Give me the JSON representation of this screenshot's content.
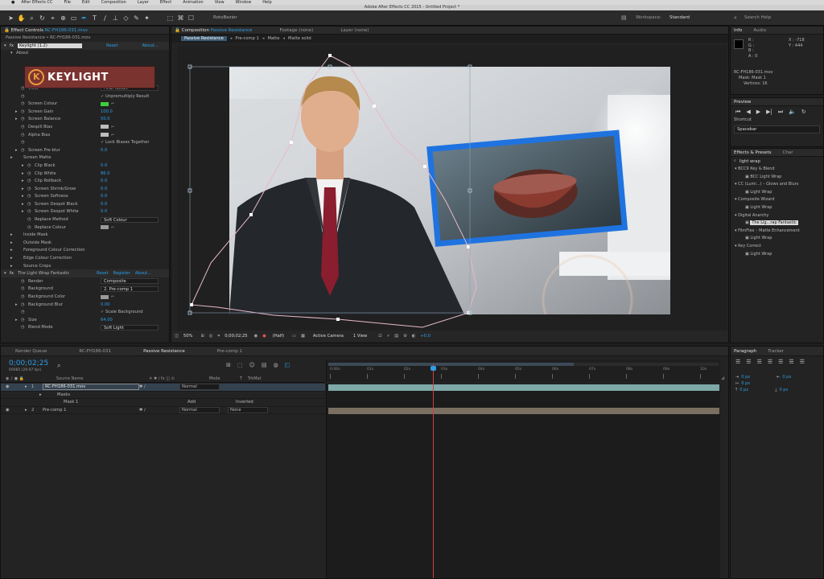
{
  "menubar": {
    "items": [
      "After Effects CC",
      "File",
      "Edit",
      "Composition",
      "Layer",
      "Effect",
      "Animation",
      "View",
      "Window",
      "Help"
    ]
  },
  "window": {
    "title": "Adobe After Effects CC 2015 - Untitled Project *"
  },
  "toolbar": {
    "rotobezier_label": "RotoBezier",
    "workspace_label": "Workspace:",
    "workspace_value": "Standard",
    "search_placeholder": "Search Help"
  },
  "effect_controls": {
    "tab_label": "Effect Controls",
    "tab_file": "RC-FH186-031.mov",
    "breadcrumb": "Passive Resistance • RC-FH186-031.mov",
    "keylight_name": "Keylight (1.2)",
    "reset": "Reset",
    "about": "About...",
    "about_label": "About",
    "logo_text": "KEYLIGHT",
    "rows": [
      {
        "name": "View",
        "value": "Final Result",
        "kind": "select"
      },
      {
        "name": "",
        "value": "✓ Unpremultiply Result",
        "kind": "check"
      },
      {
        "name": "Screen Colour",
        "value": "",
        "kind": "swatch",
        "color": "#3ccf3c"
      },
      {
        "name": "Screen Gain",
        "value": "100.0",
        "kind": "num"
      },
      {
        "name": "Screen Balance",
        "value": "50.0",
        "kind": "num"
      },
      {
        "name": "Despill Bias",
        "value": "",
        "kind": "swatch",
        "color": "#bdbdbd"
      },
      {
        "name": "Alpha Bias",
        "value": "",
        "kind": "swatch",
        "color": "#bdbdbd"
      },
      {
        "name": "",
        "value": "✓ Lock Biases Together",
        "kind": "check"
      },
      {
        "name": "Screen Pre-blur",
        "value": "0.0",
        "kind": "num"
      },
      {
        "name": "Screen Matte",
        "value": "",
        "kind": "group"
      },
      {
        "name": "Clip Black",
        "value": "0.0",
        "kind": "num"
      },
      {
        "name": "Clip White",
        "value": "86.0",
        "kind": "num"
      },
      {
        "name": "Clip Rollback",
        "value": "0.0",
        "kind": "num"
      },
      {
        "name": "Screen Shrink/Grow",
        "value": "0.0",
        "kind": "num"
      },
      {
        "name": "Screen Softness",
        "value": "0.0",
        "kind": "num"
      },
      {
        "name": "Screen Despot Black",
        "value": "0.0",
        "kind": "num"
      },
      {
        "name": "Screen Despot White",
        "value": "0.0",
        "kind": "num"
      },
      {
        "name": "Replace Method",
        "value": "Soft Colour",
        "kind": "select"
      },
      {
        "name": "Replace Colour",
        "value": "",
        "kind": "swatch",
        "color": "#9a9a9a"
      },
      {
        "name": "Inside Mask",
        "value": "",
        "kind": "group"
      },
      {
        "name": "Outside Mask",
        "value": "",
        "kind": "group"
      },
      {
        "name": "Foreground Colour Correction",
        "value": "",
        "kind": "group"
      },
      {
        "name": "Edge Colour Correction",
        "value": "",
        "kind": "group"
      },
      {
        "name": "Source Crops",
        "value": "",
        "kind": "group"
      }
    ],
    "lightwrap": {
      "name": "The Light Wrap Fantastic",
      "reset": "Reset",
      "register": "Register",
      "about": "About...",
      "rows": [
        {
          "name": "Render",
          "value": "Composite",
          "kind": "select"
        },
        {
          "name": "Background",
          "value": "2. Pre-comp 1",
          "kind": "select"
        },
        {
          "name": "Background Color",
          "value": "",
          "kind": "swatch",
          "color": "#9a9a9a"
        },
        {
          "name": "Background Blur",
          "value": "0.00",
          "kind": "num"
        },
        {
          "name": "",
          "value": "✓ Scale Background",
          "kind": "check"
        },
        {
          "name": "Size",
          "value": "64.00",
          "kind": "num"
        },
        {
          "name": "Blend Mode",
          "value": "Soft Light",
          "kind": "select"
        }
      ]
    }
  },
  "composition": {
    "tab_prefix": "Composition",
    "tab_name": "Passive Resistance",
    "footage_tab": "Footage (none)",
    "layer_tab": "Layer (none)",
    "flow": [
      "Passive Resistance",
      "Pre-comp 1",
      "Matte",
      "Matte solid"
    ],
    "zoom": "50%",
    "timecode": "0;00;02;25",
    "resolution": "(Half)",
    "camera": "Active Camera",
    "views": "1 View",
    "exposure": "+0.0"
  },
  "info": {
    "tab": "Info",
    "audio_tab": "Audio",
    "rgba": [
      "R :",
      "G :",
      "B :",
      "A : 0"
    ],
    "x": "X : -718",
    "y": "Y : 444",
    "file": "RC-FH186-031.mov",
    "mask": "Mask: Mask 1",
    "vertices": "Vertices: 16"
  },
  "preview": {
    "tab": "Preview",
    "shortcut_label": "Shortcut",
    "shortcut_value": "Spacebar"
  },
  "effects_presets": {
    "tab": "Effects & Presets",
    "char_tab": "Char",
    "search": "light wrap",
    "items": [
      {
        "text": "BCC9 Key & Blend",
        "type": "folder"
      },
      {
        "text": "BCC Light Wrap",
        "type": "item"
      },
      {
        "text": "CC (Lumi...) – Glows and Blurs",
        "type": "folder"
      },
      {
        "text": "Light Wrap",
        "type": "item"
      },
      {
        "text": "Composite Wizard",
        "type": "folder"
      },
      {
        "text": "Light Wrap",
        "type": "item"
      },
      {
        "text": "Digital Anarchy",
        "type": "folder"
      },
      {
        "text": "The Lig...rap Fantastic",
        "type": "selected"
      },
      {
        "text": "FilmFlex – Matte Enhancement",
        "type": "folder"
      },
      {
        "text": "Light Wrap",
        "type": "item"
      },
      {
        "text": "Key Correct",
        "type": "folder"
      },
      {
        "text": "Light Wrap",
        "type": "item"
      }
    ]
  },
  "timeline": {
    "tabs": [
      "Render Queue",
      "RC-FH186-031",
      "Passive Resistance",
      "Pre-comp 1"
    ],
    "timecode": "0;00;02;25",
    "fps": "00085 (29.97 fps)",
    "headers": [
      "Source Name",
      "Mode",
      "T",
      "TrkMat"
    ],
    "ruler": [
      "0:00s",
      "01s",
      "02s",
      "03s",
      "04s",
      "05s",
      "06s",
      "07s",
      "08s",
      "09s",
      "10s"
    ],
    "layers": [
      {
        "num": "1",
        "name": "RC-FH186-031.mov",
        "mode": "Normal",
        "trkmat": ""
      },
      {
        "num": "",
        "name": "Masks",
        "mode": "",
        "trkmat": ""
      },
      {
        "num": "",
        "name": "Mask 1",
        "mode": "Add",
        "trkmat": "Inverted"
      },
      {
        "num": "2",
        "name": "Pre-comp 1",
        "mode": "Normal",
        "trkmat": "None"
      }
    ]
  },
  "paragraph": {
    "tab": "Paragraph",
    "tracker_tab": "Tracker",
    "values": [
      "0 px",
      "0 px",
      "0 px",
      "0 px",
      "0 px"
    ]
  },
  "colors": {
    "accent": "#2d9ee6",
    "panel": "#232323",
    "selected": "#34424f",
    "playhead": "#d04040"
  }
}
